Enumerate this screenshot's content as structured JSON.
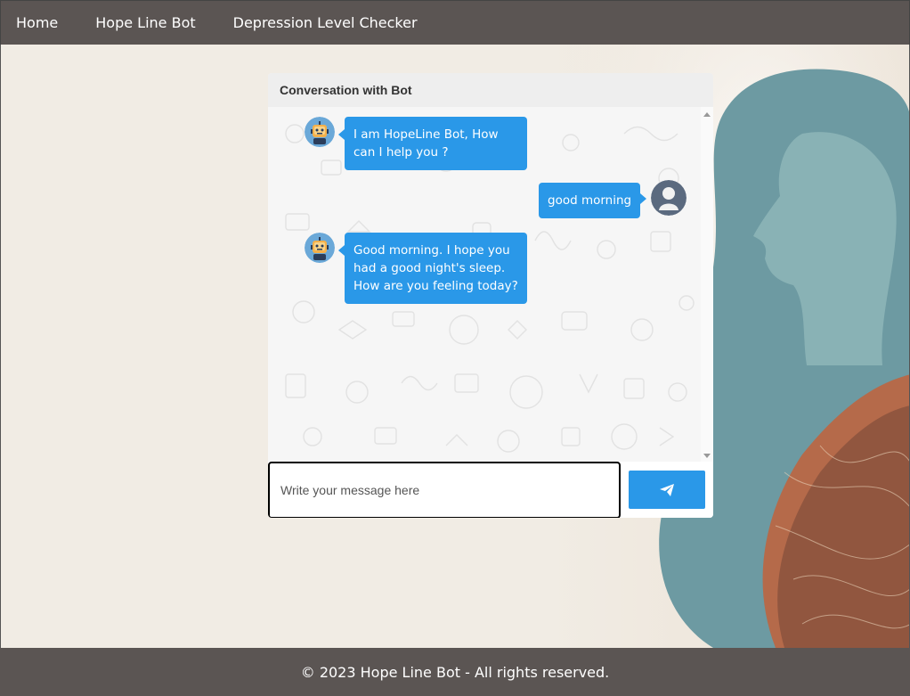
{
  "nav": {
    "items": [
      {
        "label": "Home"
      },
      {
        "label": "Hope Line Bot"
      },
      {
        "label": "Depression Level Checker"
      }
    ]
  },
  "chat": {
    "header_title": "Conversation with Bot",
    "messages": [
      {
        "sender": "bot",
        "text": "I am HopeLine Bot, How can I help you ?"
      },
      {
        "sender": "user",
        "text": "good morning"
      },
      {
        "sender": "bot",
        "text": "Good morning. I hope you had a good night's sleep. How are you feeling today?"
      }
    ],
    "input_placeholder": "Write your message here",
    "input_value": "",
    "send_icon": "paper-plane-icon"
  },
  "footer": {
    "text": "© 2023 Hope Line Bot - All rights reserved."
  },
  "colors": {
    "nav_bg": "#5b5553",
    "accent": "#2a98e8",
    "page_bg": "#f1ece4"
  }
}
